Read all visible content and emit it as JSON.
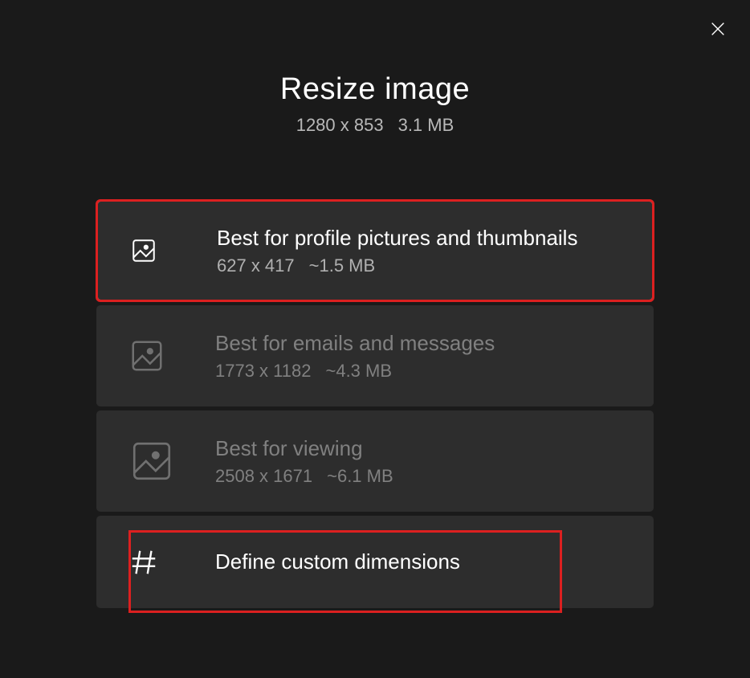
{
  "header": {
    "title": "Resize image",
    "dimensions": "1280 x 853",
    "filesize": "3.1 MB"
  },
  "options": [
    {
      "title": "Best for profile pictures and thumbnails",
      "dimensions": "627 x 417",
      "filesize": "~1.5 MB"
    },
    {
      "title": "Best for emails and messages",
      "dimensions": "1773 x 1182",
      "filesize": "~4.3 MB"
    },
    {
      "title": "Best for viewing",
      "dimensions": "2508 x 1671",
      "filesize": "~6.1 MB"
    }
  ],
  "custom": {
    "title": "Define custom dimensions"
  }
}
